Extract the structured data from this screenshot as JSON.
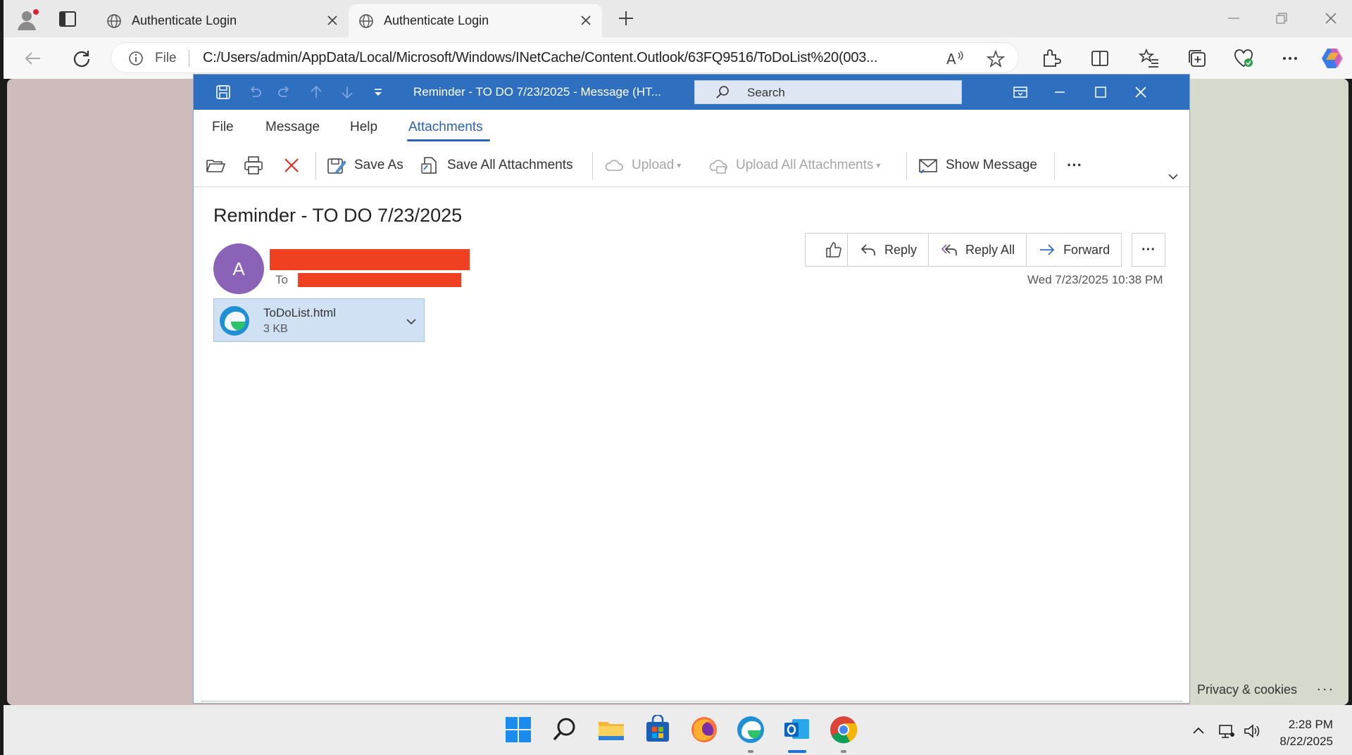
{
  "browser": {
    "tabs": [
      {
        "title": "Authenticate Login",
        "active": false
      },
      {
        "title": "Authenticate Login",
        "active": true
      }
    ],
    "address": {
      "scheme_label": "File",
      "url": "C:/Users/admin/AppData/Local/Microsoft/Windows/INetCache/Content.Outlook/63FQ9516/ToDoList%20(003..."
    }
  },
  "outlook": {
    "window_title": "Reminder - TO DO 7/23/2025  -  Message (HT...",
    "search_placeholder": "Search",
    "menu": [
      "File",
      "Message",
      "Help",
      "Attachments"
    ],
    "active_menu": "Attachments",
    "ribbon": {
      "save_as": "Save As",
      "save_all": "Save All Attachments",
      "upload": "Upload",
      "upload_all": "Upload All Attachments",
      "show_message": "Show Message",
      "more": "···"
    },
    "message": {
      "subject": "Reminder - TO DO 7/23/2025",
      "avatar_initial": "A",
      "to_label": "To",
      "date": "Wed 7/23/2025 10:38 PM",
      "actions": {
        "reply": "Reply",
        "reply_all": "Reply All",
        "forward": "Forward",
        "more": "···"
      },
      "attachment": {
        "name": "ToDoList.html",
        "size": "3 KB"
      }
    }
  },
  "page": {
    "privacy": "Privacy & cookies",
    "privacy_more": "..."
  },
  "taskbar": {
    "time": "2:28 PM",
    "date": "8/22/2025"
  },
  "colors": {
    "outlook_blue": "#2f6fc0",
    "redaction": "#ef4121",
    "avatar": "#8a62b8"
  }
}
